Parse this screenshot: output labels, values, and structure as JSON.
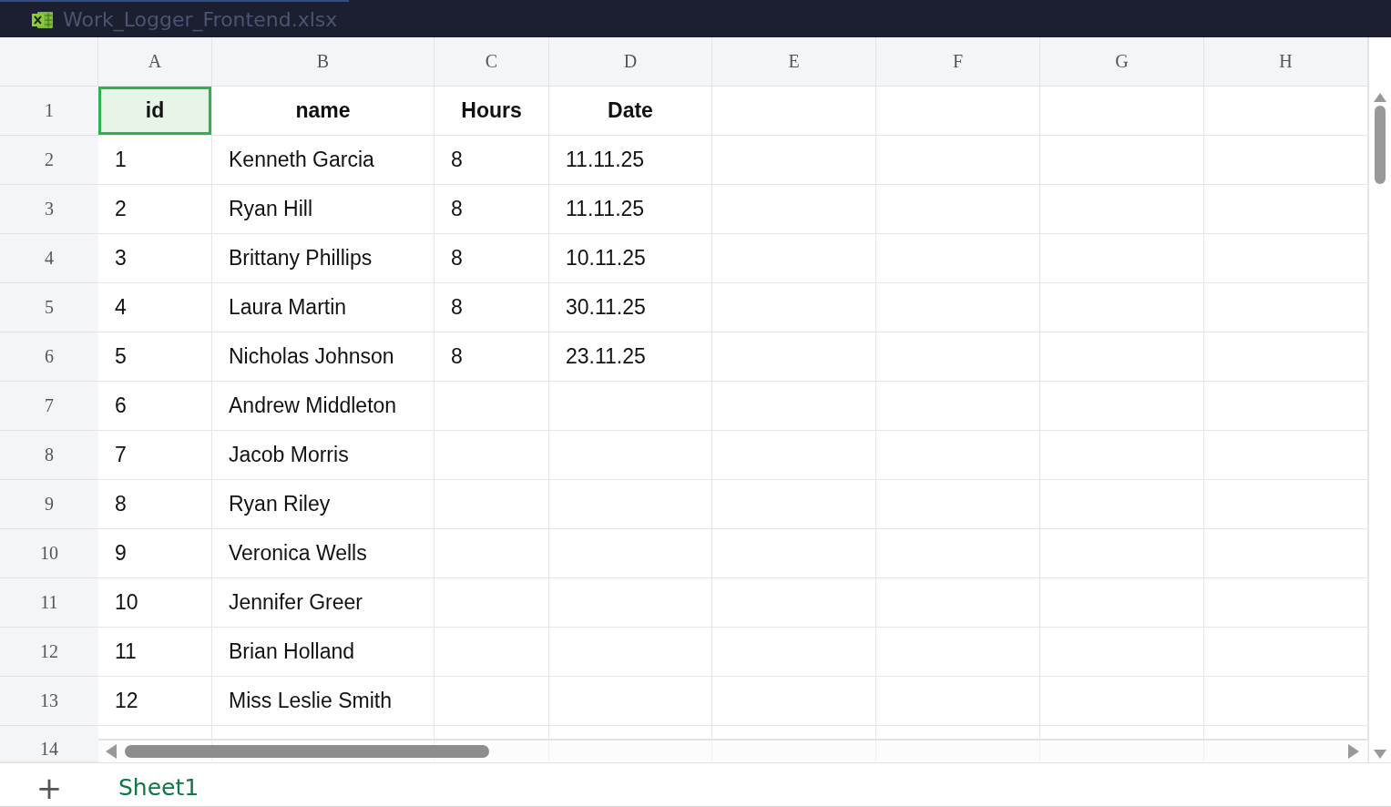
{
  "window": {
    "title": "Work_Logger_Frontend.xlsx"
  },
  "columns": [
    {
      "label": "A"
    },
    {
      "label": "B"
    },
    {
      "label": "C"
    },
    {
      "label": "D"
    },
    {
      "label": "E"
    },
    {
      "label": "F"
    },
    {
      "label": "G"
    },
    {
      "label": "H"
    }
  ],
  "rows": [
    {
      "label": "1",
      "kind": "header",
      "cells": [
        {
          "text": "id",
          "selected": true
        },
        {
          "text": "name",
          "selected": false
        },
        {
          "text": "Hours",
          "selected": false
        },
        {
          "text": "Date",
          "selected": false
        }
      ]
    },
    {
      "label": "2",
      "kind": "data",
      "cells": [
        {
          "text": "1",
          "selected": false
        },
        {
          "text": "Kenneth Garcia",
          "selected": false
        },
        {
          "text": "8",
          "selected": false
        },
        {
          "text": "11.11.25",
          "selected": false
        }
      ]
    },
    {
      "label": "3",
      "kind": "data",
      "cells": [
        {
          "text": "2",
          "selected": false
        },
        {
          "text": "Ryan Hill",
          "selected": false
        },
        {
          "text": "8",
          "selected": false
        },
        {
          "text": "11.11.25",
          "selected": false
        }
      ]
    },
    {
      "label": "4",
      "kind": "data",
      "cells": [
        {
          "text": "3",
          "selected": false
        },
        {
          "text": "Brittany Phillips",
          "selected": false
        },
        {
          "text": "8",
          "selected": false
        },
        {
          "text": "10.11.25",
          "selected": false
        }
      ]
    },
    {
      "label": "5",
      "kind": "data",
      "cells": [
        {
          "text": "4",
          "selected": false
        },
        {
          "text": "Laura Martin",
          "selected": false
        },
        {
          "text": "8",
          "selected": false
        },
        {
          "text": "30.11.25",
          "selected": false
        }
      ]
    },
    {
      "label": "6",
      "kind": "data",
      "cells": [
        {
          "text": "5",
          "selected": false
        },
        {
          "text": "Nicholas Johnson",
          "selected": false
        },
        {
          "text": "8",
          "selected": false
        },
        {
          "text": "23.11.25",
          "selected": false
        }
      ]
    },
    {
      "label": "7",
      "kind": "data",
      "cells": [
        {
          "text": "6",
          "selected": false
        },
        {
          "text": "Andrew Middleton",
          "selected": false
        }
      ]
    },
    {
      "label": "8",
      "kind": "data",
      "cells": [
        {
          "text": "7",
          "selected": false
        },
        {
          "text": "Jacob Morris",
          "selected": false
        }
      ]
    },
    {
      "label": "9",
      "kind": "data",
      "cells": [
        {
          "text": "8",
          "selected": false
        },
        {
          "text": "Ryan Riley",
          "selected": false
        }
      ]
    },
    {
      "label": "10",
      "kind": "data",
      "cells": [
        {
          "text": "9",
          "selected": false
        },
        {
          "text": "Veronica Wells",
          "selected": false
        }
      ]
    },
    {
      "label": "11",
      "kind": "data",
      "cells": [
        {
          "text": "10",
          "selected": false
        },
        {
          "text": "Jennifer Greer",
          "selected": false
        }
      ]
    },
    {
      "label": "12",
      "kind": "data",
      "cells": [
        {
          "text": "11",
          "selected": false
        },
        {
          "text": "Brian Holland",
          "selected": false
        }
      ]
    },
    {
      "label": "13",
      "kind": "data",
      "cells": [
        {
          "text": "12",
          "selected": false
        },
        {
          "text": "Miss Leslie Smith",
          "selected": false
        }
      ]
    },
    {
      "label": "14",
      "kind": "covered",
      "cells": []
    }
  ],
  "sheets": [
    {
      "label": "Sheet1",
      "selected": true
    }
  ],
  "add_sheet": {
    "label": "+"
  }
}
